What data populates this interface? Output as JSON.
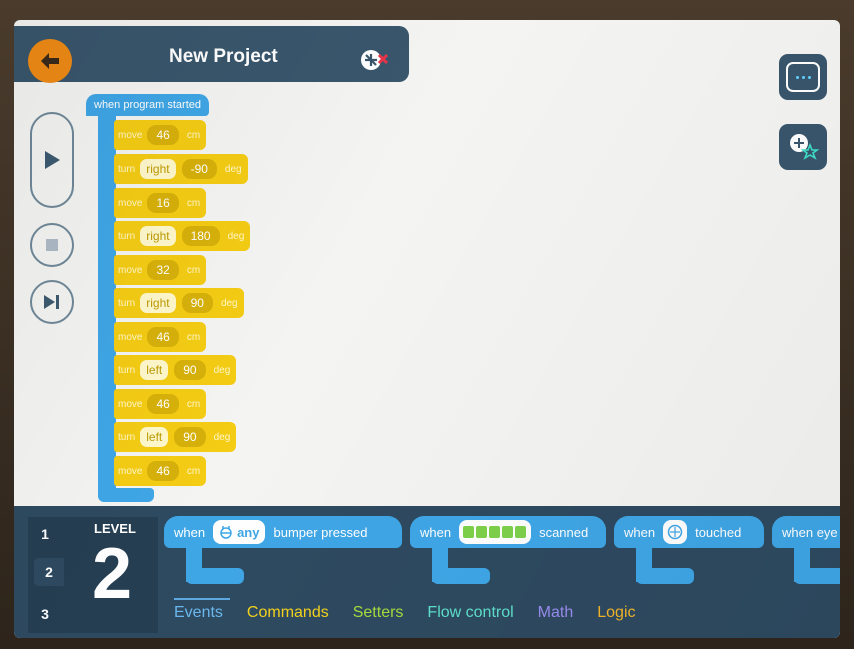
{
  "header": {
    "title": "New Project"
  },
  "program": {
    "event_label": "when program started",
    "blocks": [
      {
        "kw": "move",
        "value": "46",
        "unit": "cm"
      },
      {
        "kw": "turn",
        "dir": "right",
        "value": "-90",
        "unit": "deg"
      },
      {
        "kw": "move",
        "value": "16",
        "unit": "cm"
      },
      {
        "kw": "turn",
        "dir": "right",
        "value": "180",
        "unit": "deg"
      },
      {
        "kw": "move",
        "value": "32",
        "unit": "cm"
      },
      {
        "kw": "turn",
        "dir": "right",
        "value": "90",
        "unit": "deg"
      },
      {
        "kw": "move",
        "value": "46",
        "unit": "cm"
      },
      {
        "kw": "turn",
        "dir": "left",
        "value": "90",
        "unit": "deg"
      },
      {
        "kw": "move",
        "value": "46",
        "unit": "cm"
      },
      {
        "kw": "turn",
        "dir": "left",
        "value": "90",
        "unit": "deg"
      },
      {
        "kw": "move",
        "value": "46",
        "unit": "cm"
      }
    ]
  },
  "level": {
    "label": "LEVEL",
    "current": "2",
    "options": [
      "1",
      "2",
      "3"
    ]
  },
  "palette": {
    "blocks": [
      {
        "pre": "when",
        "chip": "any",
        "post": "bumper pressed"
      },
      {
        "pre": "when",
        "post": "scanned"
      },
      {
        "pre": "when",
        "post": "touched"
      },
      {
        "pre": "when eye"
      }
    ]
  },
  "categories": [
    {
      "label": "Events",
      "color": "#6ab8ef"
    },
    {
      "label": "Commands",
      "color": "#f4d21c"
    },
    {
      "label": "Setters",
      "color": "#a6dc3c"
    },
    {
      "label": "Flow control",
      "color": "#5ee0cc"
    },
    {
      "label": "Math",
      "color": "#9a8cf0"
    },
    {
      "label": "Logic",
      "color": "#f2b52a"
    }
  ]
}
